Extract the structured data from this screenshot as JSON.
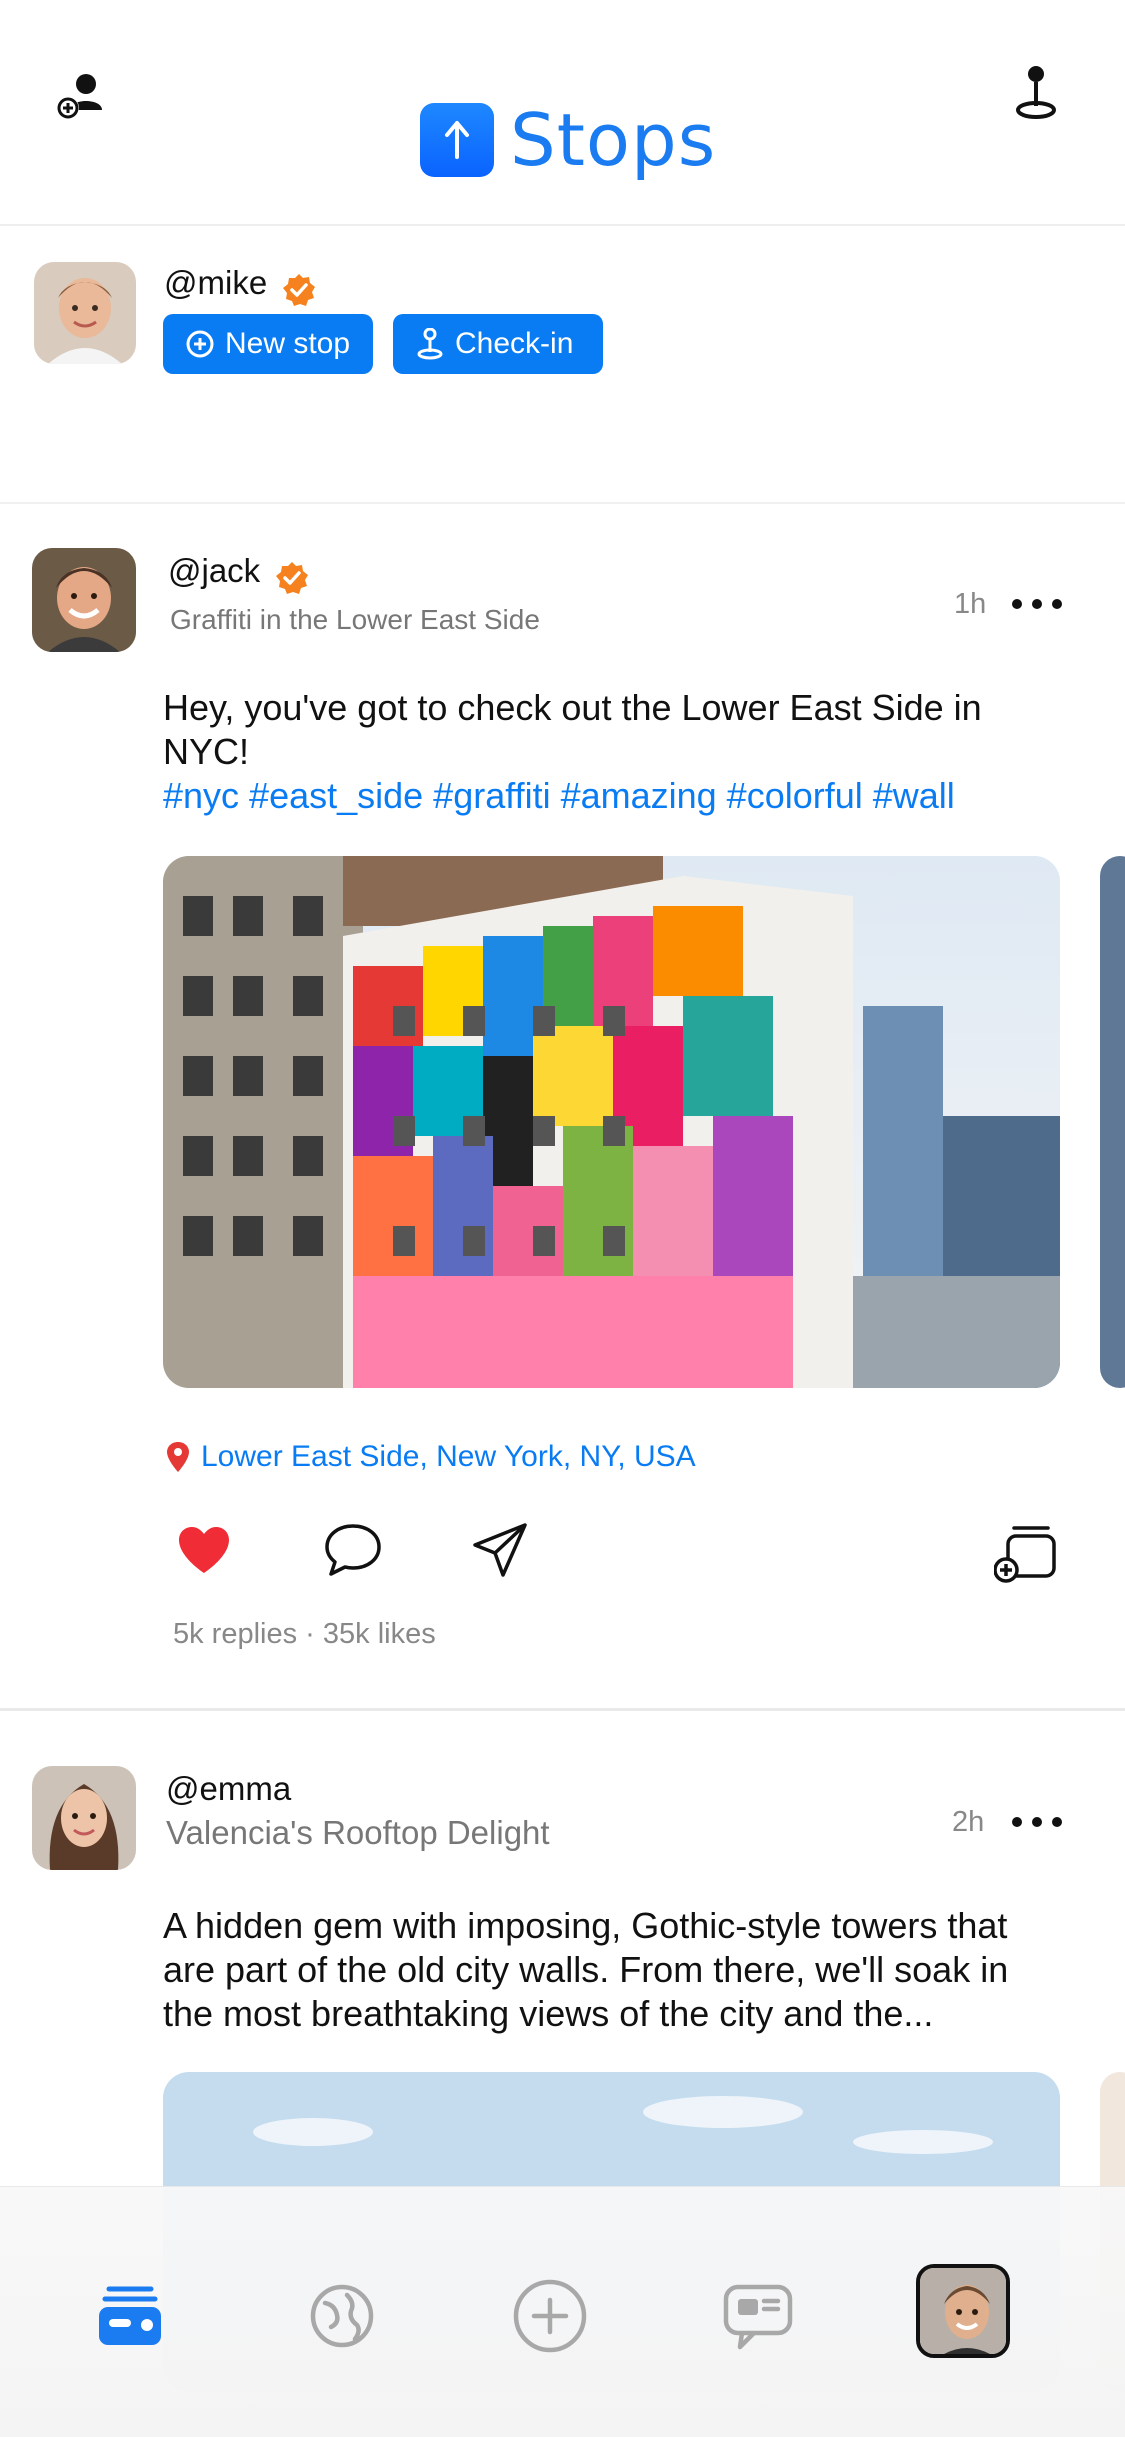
{
  "app": {
    "name": "Stops",
    "brand_color": "#1a7cf0",
    "accent": "#0a7cf3",
    "verified_color": "#f5821f"
  },
  "header": {
    "left_icon": "add-user-icon",
    "right_icon": "check-in-pin-icon"
  },
  "composer": {
    "handle": "@mike",
    "verified": true,
    "new_stop_label": "New stop",
    "checkin_label": "Check-in"
  },
  "posts": [
    {
      "handle": "@jack",
      "verified": true,
      "title": "Graffiti in the Lower East Side",
      "time": "1h",
      "body": "Hey, you've got to check out the Lower East Side in NYC!",
      "tags": "#nyc #east_side #graffiti #amazing #colorful #wall",
      "location": "Lower East Side, New York, NY, USA",
      "stats": "5k replies · 35k likes",
      "liked": true
    },
    {
      "handle": "@emma",
      "verified": false,
      "title": "Valencia's Rooftop Delight",
      "time": "2h",
      "body_lines": [
        "A hidden gem with imposing, Gothic-style towers that",
        "are part of the old city walls. From there, we'll soak in",
        "the most breathtaking views of the city and the..."
      ]
    }
  ],
  "nav": {
    "items": [
      "feed-icon",
      "globe-icon",
      "add-icon",
      "messages-icon",
      "profile-avatar"
    ],
    "active": "feed-icon"
  }
}
